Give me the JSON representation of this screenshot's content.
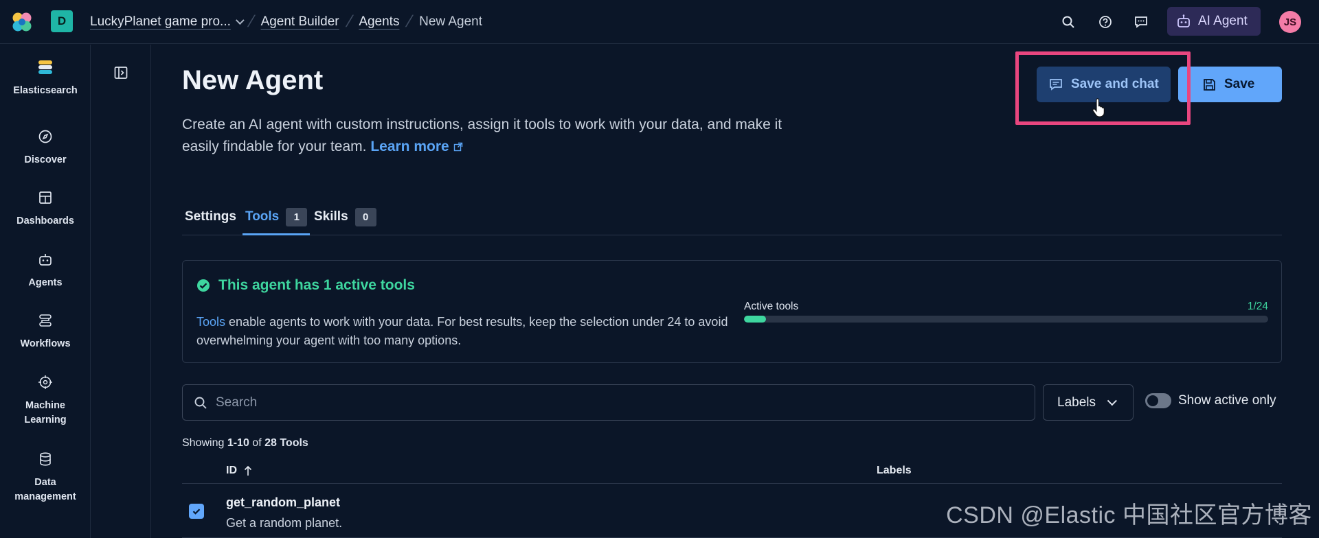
{
  "topbar": {
    "space_letter": "D",
    "breadcrumbs": [
      "LuckyPlanet game pro...",
      "Agent Builder",
      "Agents",
      "New Agent"
    ],
    "ai_agent_label": "AI Agent",
    "avatar_initials": "JS"
  },
  "nav": {
    "items": [
      {
        "label": "Elasticsearch",
        "icon": "elasticsearch-icon"
      },
      {
        "label": "Discover",
        "icon": "compass-icon"
      },
      {
        "label": "Dashboards",
        "icon": "dashboard-icon"
      },
      {
        "label": "Agents",
        "icon": "robot-icon"
      },
      {
        "label": "Workflows",
        "icon": "workflow-icon"
      },
      {
        "label": "Machine Learning",
        "icon": "brain-icon"
      },
      {
        "label": "Data management",
        "icon": "database-icon"
      }
    ]
  },
  "page": {
    "title": "New Agent",
    "description": "Create an AI agent with custom instructions, assign it tools to work with your data, and make it easily findable for your team.",
    "learn_more": "Learn more",
    "save_and_chat_label": "Save and chat",
    "save_label": "Save"
  },
  "tabs": [
    {
      "label": "Settings",
      "count": null,
      "active": false
    },
    {
      "label": "Tools",
      "count": "1",
      "active": true
    },
    {
      "label": "Skills",
      "count": "0",
      "active": false
    }
  ],
  "info": {
    "title": "This agent has 1 active tools",
    "text_link": "Tools",
    "text_rest": " enable agents to work with your data. For best results, keep the selection under 24 to avoid overwhelming your agent with too many options.",
    "progress_label": "Active tools",
    "progress_ratio": "1/24",
    "progress_fraction": 0.0417
  },
  "filters": {
    "search_placeholder": "Search",
    "labels_button": "Labels",
    "show_active_only": "Show active only"
  },
  "table": {
    "showing_prefix": "Showing ",
    "showing_range": "1-10",
    "showing_of": " of ",
    "showing_total": "28",
    "showing_suffix": "Tools",
    "col_id": "ID",
    "col_labels": "Labels",
    "rows": [
      {
        "name": "get_random_planet",
        "description": "Get a random planet.",
        "checked": true
      }
    ]
  },
  "watermark": "CSDN @Elastic 中国社区官方博客",
  "colors": {
    "background": "#0b1628",
    "accent": "#61a6fa",
    "success": "#3ed69f",
    "highlight": "#e9467f",
    "ai_agent_bg": "#2d2a57"
  }
}
